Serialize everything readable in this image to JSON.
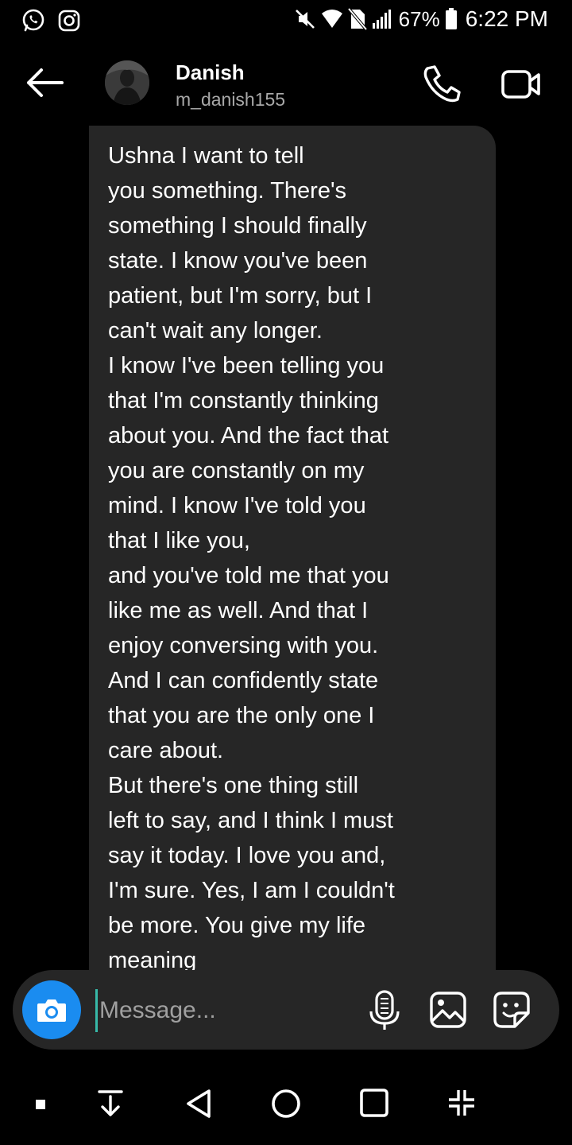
{
  "status_bar": {
    "battery_percent": "67%",
    "time": "6:22 PM",
    "left_icons": [
      "whatsapp-icon",
      "instagram-icon"
    ],
    "right_icons": [
      "mute-icon",
      "wifi-icon",
      "no-sim-icon",
      "signal-icon",
      "battery-icon"
    ]
  },
  "header": {
    "contact_name": "Danish",
    "contact_handle": "m_danish155",
    "icons": [
      "back-arrow-icon",
      "phone-icon",
      "video-camera-icon"
    ]
  },
  "message": {
    "text": "Ushna I want to tell\nyou something. There's\nsomething I should finally\nstate. I know you've been\npatient, but I'm sorry, but I\ncan't wait any longer.\nI know I've been telling you\nthat I'm constantly thinking\nabout you. And the fact that\nyou are constantly on my\nmind. I know I've told you\nthat I like you,\nand you've told me that you\nlike me as well. And that I\nenjoy conversing with you.\nAnd I can confidently state\nthat you are the only one I\ncare about.\nBut there's one thing still\nleft to say, and I think I must\nsay it today. I love you and,\nI'm sure. Yes, I am I couldn't\nbe more. You give my life\nmeaning"
  },
  "composer": {
    "placeholder": "Message...",
    "value": "",
    "icons": [
      "camera-icon",
      "microphone-icon",
      "gallery-icon",
      "sticker-icon"
    ]
  },
  "nav_bar": {
    "icons": [
      "dot-icon",
      "download-bar-icon",
      "back-triangle-icon",
      "home-circle-icon",
      "recents-square-icon",
      "collapse-icon"
    ]
  },
  "colors": {
    "background": "#000000",
    "bubble": "#262626",
    "composer": "#262626",
    "camera_button": "#1a8cf0",
    "secondary_text": "#a8a8a8",
    "cursor": "#37b9a8"
  }
}
